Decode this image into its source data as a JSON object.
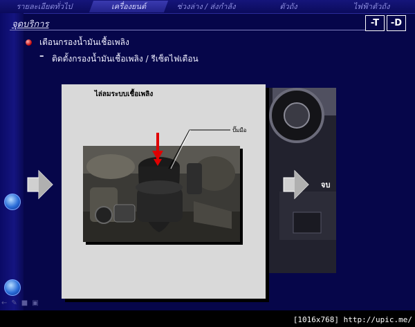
{
  "nav": {
    "tabs": [
      {
        "label": "รายละเอียดทั่วไป",
        "active": false
      },
      {
        "label": "เครื่องยนต์",
        "active": true
      },
      {
        "label": "ช่วงล่าง / ส่งกำลัง",
        "active": false
      },
      {
        "label": "ตัวถัง",
        "active": false
      },
      {
        "label": "ไฟฟ้าตัวถัง",
        "active": false
      }
    ]
  },
  "header": {
    "title": "จุดบริการ",
    "btn_t": "-T",
    "btn_d": "-D"
  },
  "body": {
    "item1": "เตือนกรองน้ำมันเชื้อเพลิง",
    "dash": "–",
    "item2": "ติดตั้งกรองน้ำมันเชื้อเพลิง / รีเซ็ตไฟเตือน"
  },
  "panel": {
    "title": "ไล่ลมระบบเชื้อเพลิง",
    "callout": "ปั๊มมือ"
  },
  "next": {
    "label": "จบ"
  },
  "footer": {
    "resolution": "[1016x768] http://upic.me/"
  },
  "colors": {
    "background": "#06064a",
    "accent": "#c00000",
    "panel": "#d9d9d9"
  }
}
